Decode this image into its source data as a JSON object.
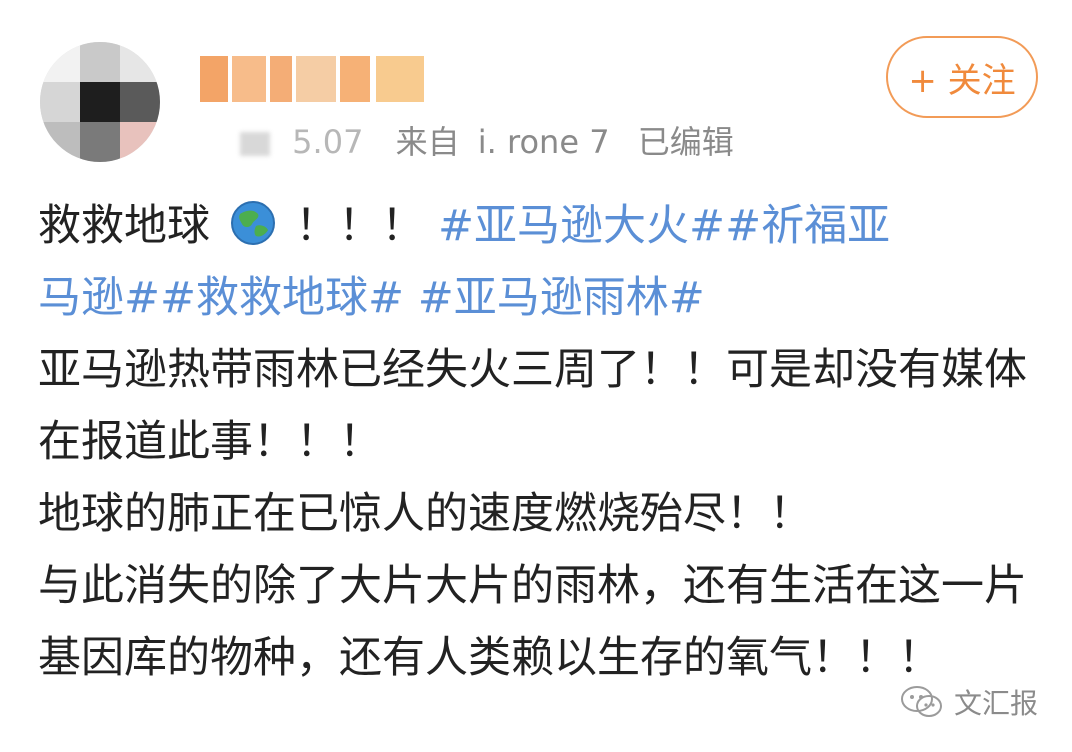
{
  "header": {
    "username_obscured": true,
    "meta": {
      "time_obscured": "5.07",
      "source_prefix": "来自",
      "source_device": "i. rone 7",
      "edited_label": "已编辑"
    },
    "follow_button": {
      "label": "+ 关注"
    }
  },
  "post": {
    "line1_prefix": "救救地球",
    "line1_suffix": "！！！",
    "hashtags_line1": "#亚马逊大火##祈福亚",
    "hashtags_line2": "马逊##救救地球# #亚马逊雨林#",
    "paragraph2": "亚马逊热带雨林已经失火三周了！！可是却没有媒体在报道此事！！！",
    "paragraph3": "地球的肺正在已惊人的速度燃烧殆尽！！",
    "paragraph4": "与此消失的除了大片大片的雨林，还有生活在这一片基因库的物种，还有人类赖以生存的氧气！！！"
  },
  "watermark": {
    "label": "文汇报"
  },
  "colors": {
    "accent_follow": "#f08a3c",
    "hashtag": "#5b8fd6",
    "text": "#222222",
    "meta": "#8a8a8a"
  }
}
